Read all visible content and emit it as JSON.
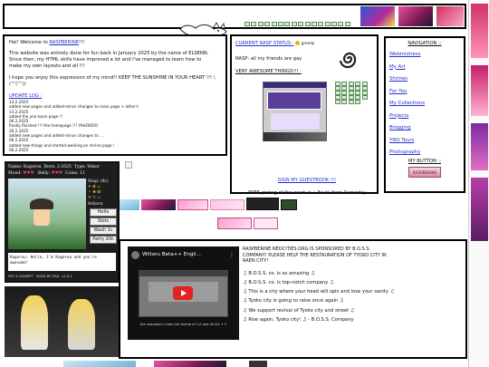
{
  "welcome": {
    "heading_prefix": "Hai! Welcome to ",
    "heading_link": "RASPBERINE",
    "heading_suffix": "!!!",
    "paragraphs": [
      "This website was entirely done for fun back in January 2025 by the name of ELSENN. Since then, my HTML skills have improved a lot and I've managed to learn how to make my own layouts and all !!!",
      "I hope you enjoy this expression of my mind!! KEEP THE SUNSHINE IN YOUR HEART !!! \\(^▽^)/"
    ],
    "update_title": "UPDATE LOG :",
    "update_log": [
      "13.2.2025",
      "added new pages and added minor changes to main page + other's",
      "13.2.2025",
      "added the yno tours page !!",
      "06.2.2025",
      "finally finished !!! the homepage !!! YAHOOOO",
      "26.2.2025",
      "added new pages and added minor changes to ...",
      "06.2.2025",
      "added new things and started working on shrine page !",
      "06.2.2025"
    ]
  },
  "status": {
    "title": "CURRENT RASP STATUS :",
    "mood": "greedy",
    "line1": "RASP: all my friends are gay",
    "things_title": "VERY AWESOME THINGS!!! :",
    "protag": "YNF6 protag of the week is :: Itsuki from Someday",
    "guestbook": "SIGN MY GUESTBOOK !!!"
  },
  "nav": {
    "title": "NAVIGATION ::",
    "items": [
      "Webmistress",
      "My Art",
      "Shrines",
      "For You",
      "My Collections",
      "Projects",
      "Blogging",
      "YNO Tours",
      "Photography"
    ],
    "button_title": "MY BUTTON ::",
    "button_label": "RASPBERINE"
  },
  "pet": {
    "name_label": "Name: Kagerou",
    "born_label": "Born: 2-2025",
    "type_label": "Type: Water",
    "mood_label": "Mood:",
    "belly_label": "Belly:",
    "coins_label": "Coins: 11",
    "shop_label": "Shop: (9c)",
    "actions_label": "Actions:",
    "actions": [
      "Hello",
      "Slots",
      "Wash 1c",
      "Party 20c"
    ],
    "message": "Kagerou: Hello, I'm Kagerou and you're awesome!",
    "footer": "GET A GIGAPET · MADE BY SHA · v1.0.1"
  },
  "video": {
    "title": "Wiitoru Beta++ Engli...",
    "caption": "the someday's main bar theme of 1.0 and dir-ls3 + 2"
  },
  "sponsor": {
    "header": "RASPBERINE.NEOCITIES.ORG IS SPONSORED BY B.O.S.S. COMPANY! PLEASE HELP THE RESTAURATION OF TYOKO CITY IN RAEN CITY!",
    "lines": [
      "B.O.S.S. co. is so amazing",
      "B.O.S.S. co. is top-notch company",
      "This is a city where your head will spin and lose your sanity",
      "Tyoko city is going to raise once again",
      "We support revival of Tyoko city and street",
      "Rise again, Tyoko city! ♫ - B.O.S.S. Company"
    ]
  },
  "toptext": {
    "flag_count": "16"
  },
  "colors": {
    "border": "#000000",
    "link": "#2530c8",
    "pet_bg": "#2d6a2a"
  }
}
